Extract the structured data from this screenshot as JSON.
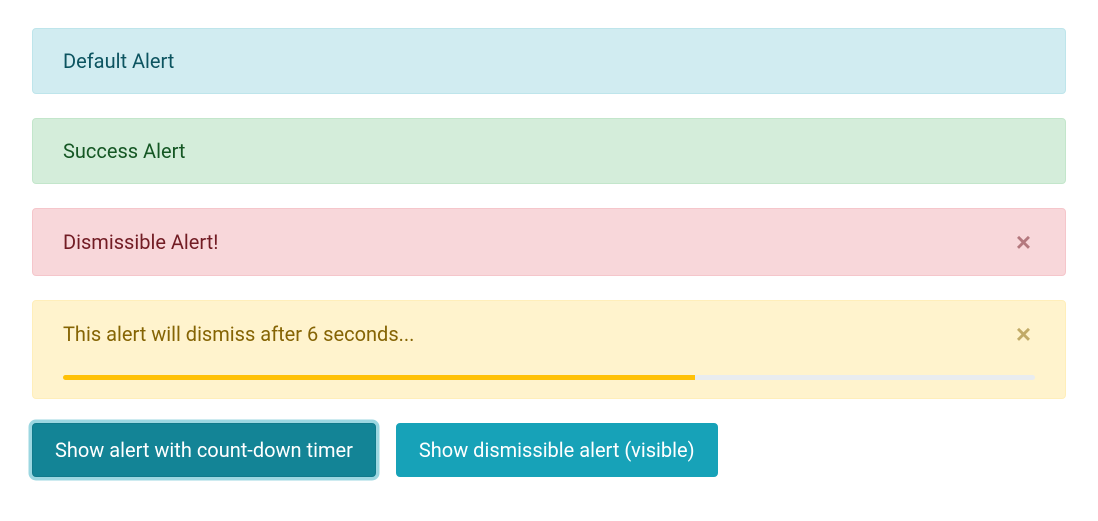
{
  "alerts": {
    "default": {
      "text": "Default Alert"
    },
    "success": {
      "text": "Success Alert"
    },
    "dismissible": {
      "text": "Dismissible Alert!"
    },
    "countdown": {
      "text": "This alert will dismiss after 6 seconds...",
      "progress_percent": "65"
    }
  },
  "buttons": {
    "show_countdown": "Show alert with count-down timer",
    "show_dismissible": "Show dismissible alert (visible)"
  },
  "colors": {
    "info_bg": "#d1ecf1",
    "success_bg": "#d4edda",
    "danger_bg": "#f8d7da",
    "warning_bg": "#fff3cd",
    "primary_btn": "#17a2b8",
    "progress_bar": "#ffc107"
  }
}
